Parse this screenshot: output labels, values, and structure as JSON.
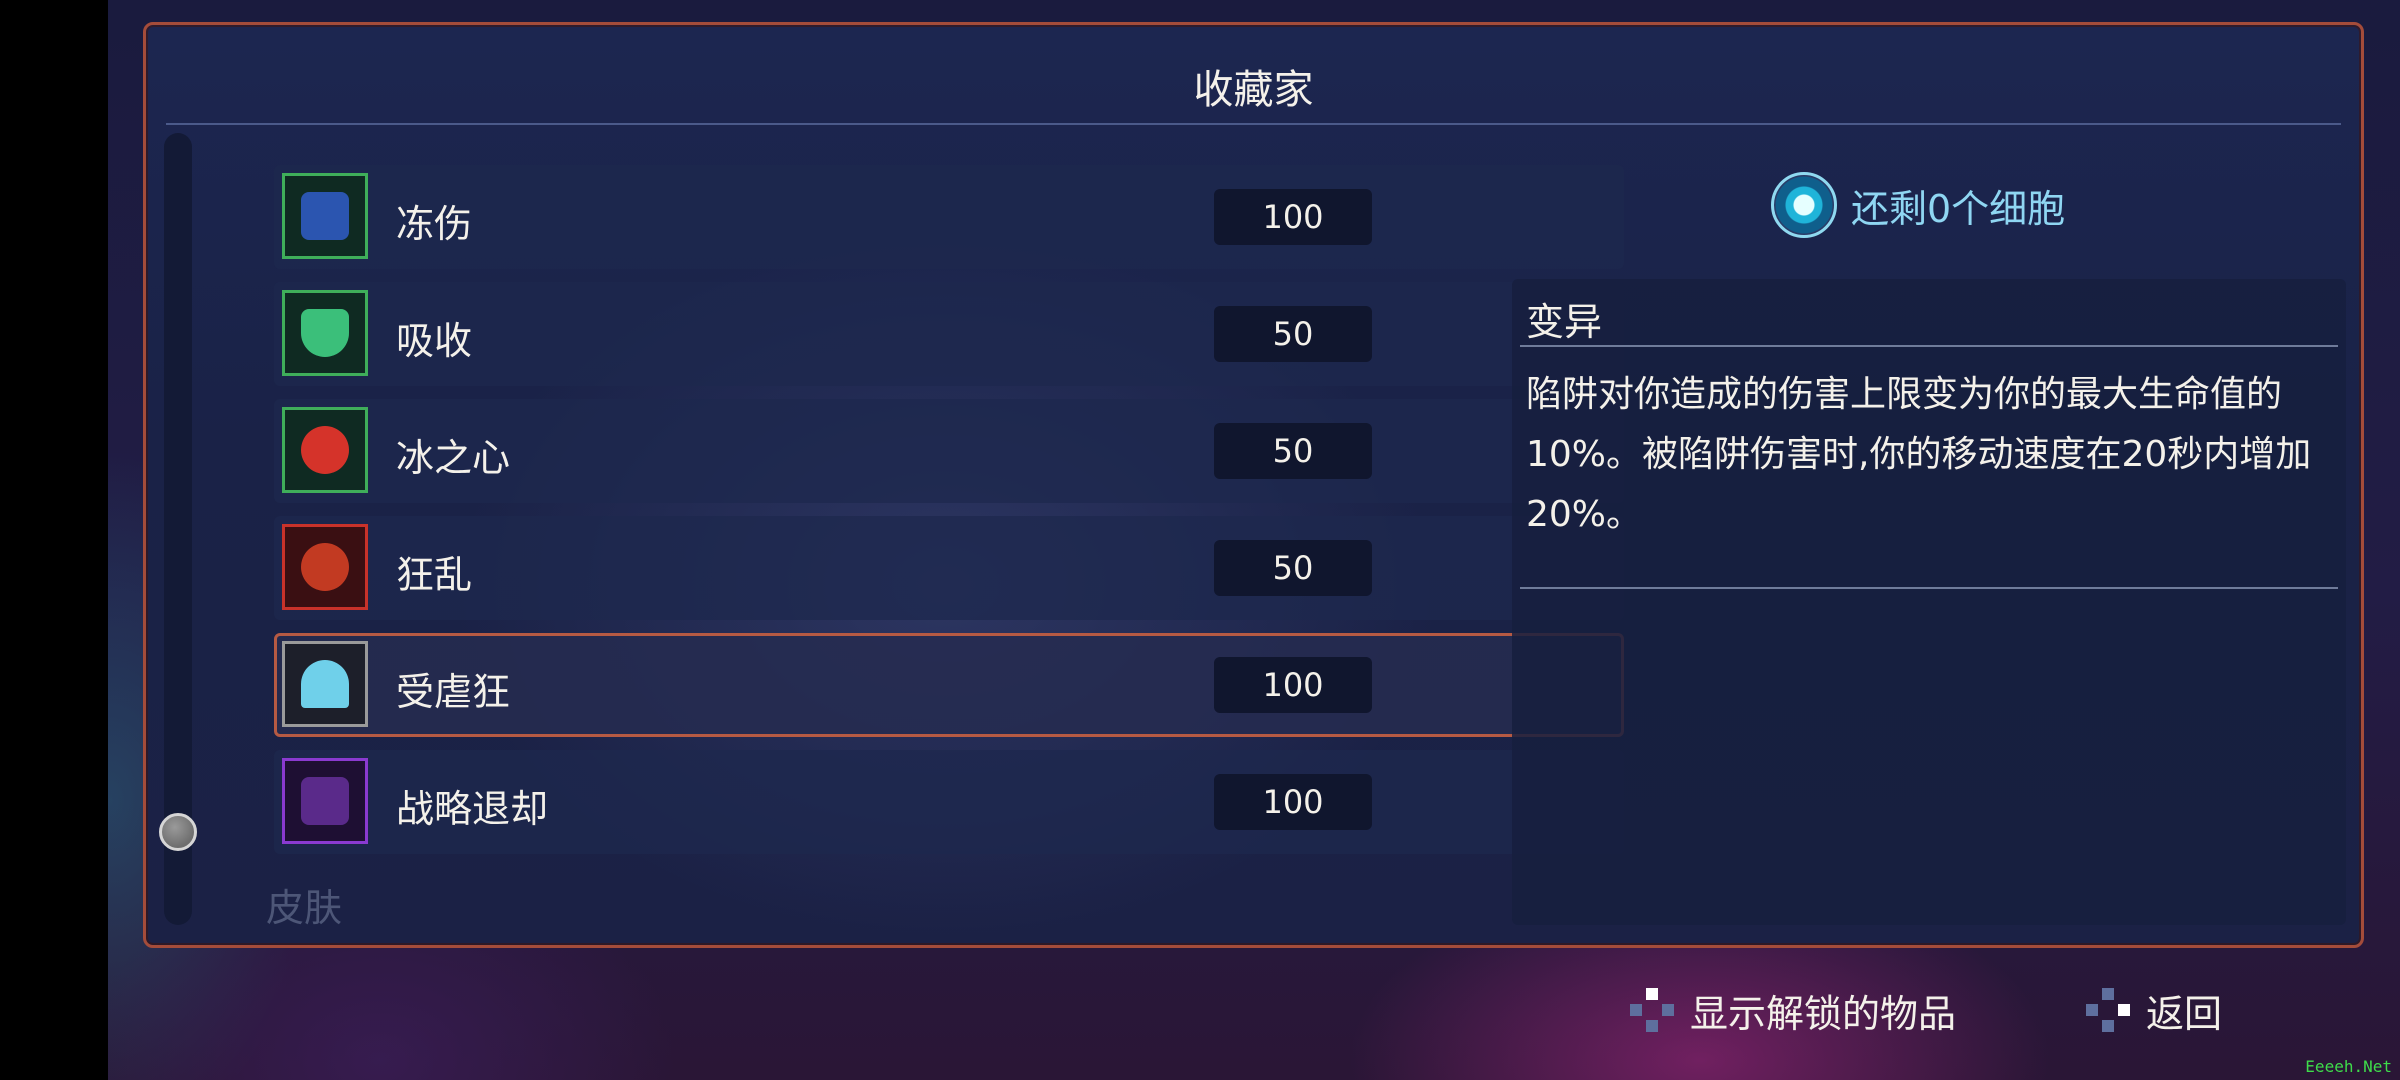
{
  "panel": {
    "title": "收藏家"
  },
  "items": [
    {
      "label": "冻伤",
      "value": "100",
      "icon": "frostbite-icon",
      "border": "#3fae5a",
      "fill": "#2b55b0"
    },
    {
      "label": "吸收",
      "value": "50",
      "icon": "absorb-shield-icon",
      "border": "#3fae5a",
      "fill": "#3bbf7a"
    },
    {
      "label": "冰之心",
      "value": "50",
      "icon": "ice-heart-icon",
      "border": "#3fae5a",
      "fill": "#d5332a"
    },
    {
      "label": "狂乱",
      "value": "50",
      "icon": "frenzy-icon",
      "border": "#c8322a",
      "fill": "#c23a22"
    },
    {
      "label": "受虐狂",
      "value": "100",
      "icon": "masochist-icon",
      "border": "#9a9a9a",
      "fill": "#6fd0ea",
      "selected": true
    },
    {
      "label": "战略退却",
      "value": "100",
      "icon": "tactical-retreat-icon",
      "border": "#8a3ad0",
      "fill": "#5a2a8a"
    }
  ],
  "faded_label": "皮肤",
  "cells": {
    "text": "还剩0个细胞",
    "icon": "cell-icon"
  },
  "description": {
    "title": "变异",
    "body": "陷阱对你造成的伤害上限变为你的最大生命值的10%。被陷阱伤害时,你的移动速度在20秒内增加20%。"
  },
  "footer": {
    "show_unlocked_label": "显示解锁的物品",
    "back_label": "返回"
  },
  "watermark": "Eeeeh.Net"
}
